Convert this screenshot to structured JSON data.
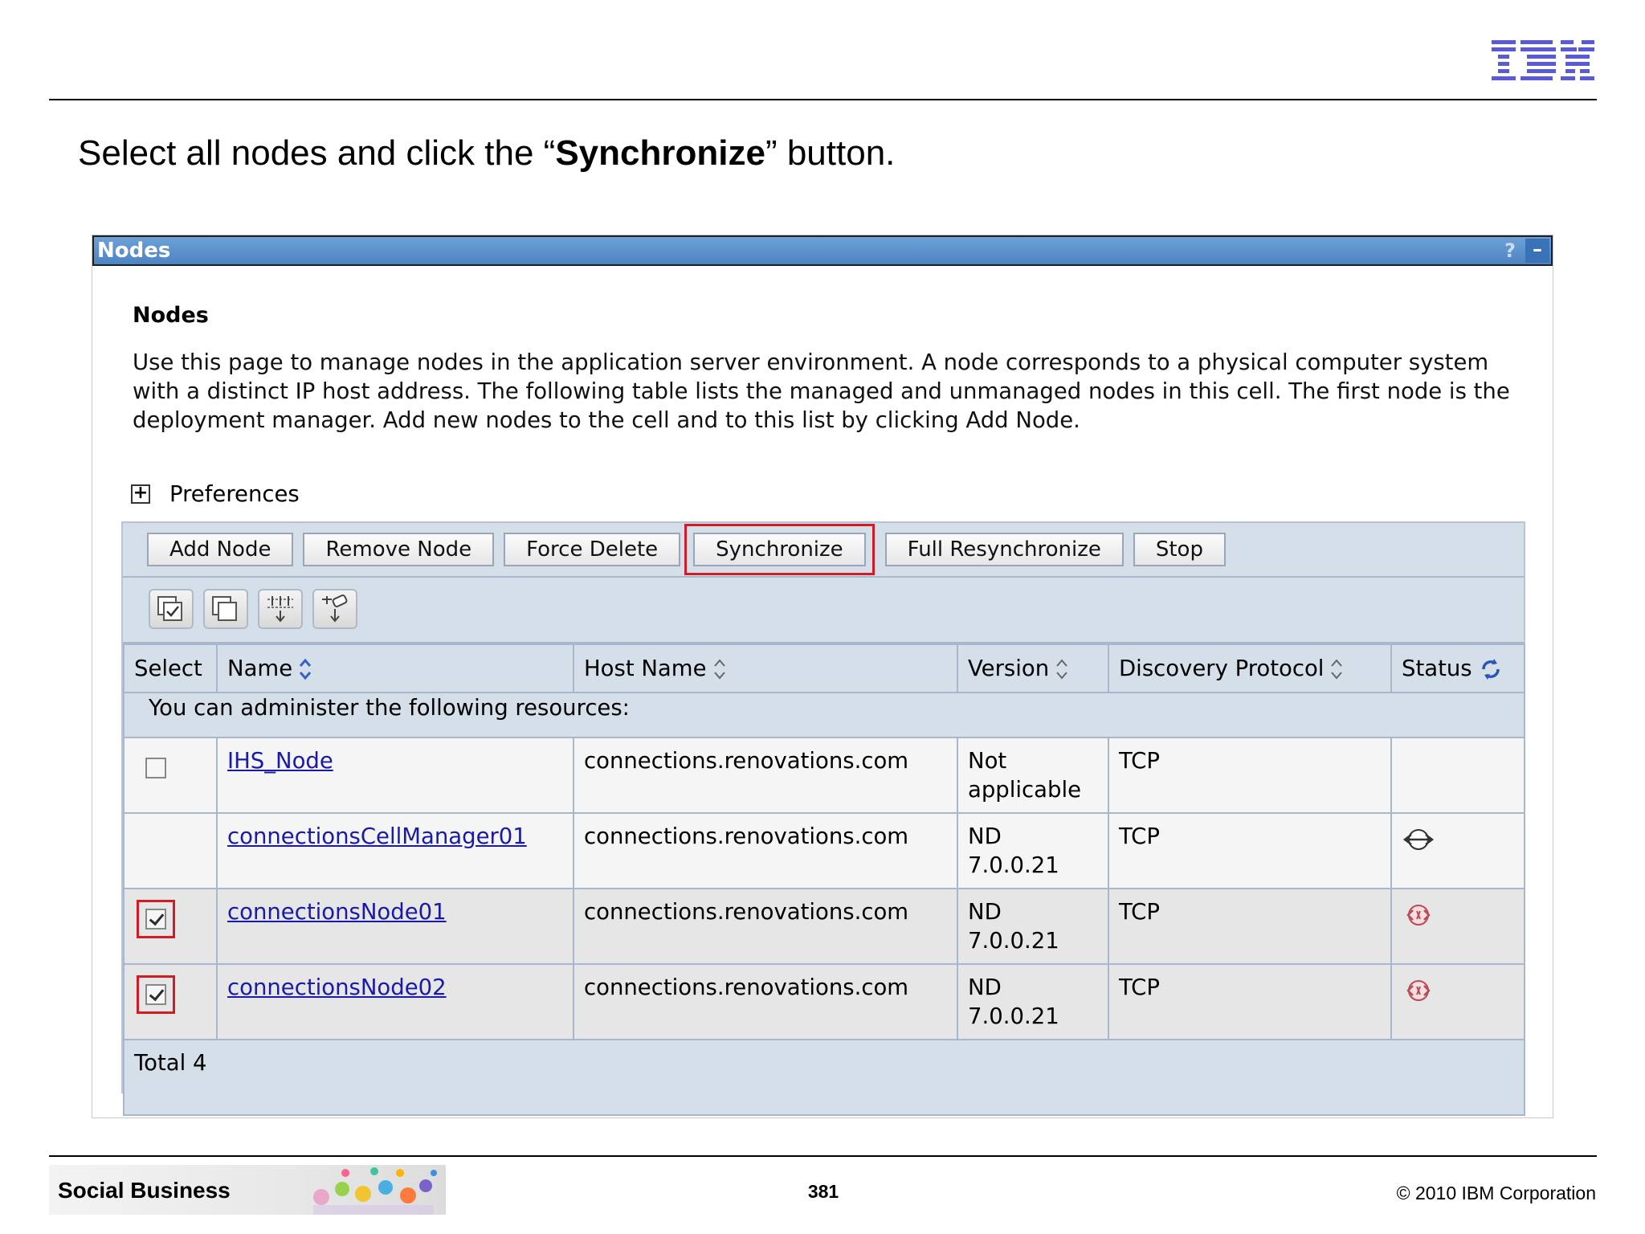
{
  "slide": {
    "title_prefix": "Select all nodes and click the “",
    "title_bold": "Synchronize",
    "title_suffix": "” button.",
    "footer_brand": "Social Business",
    "page_number": "381",
    "copyright": "© 2010 IBM Corporation",
    "logo_text": "IBM"
  },
  "portlet": {
    "title": "Nodes",
    "help_icon": "?",
    "minimize_icon": "–",
    "heading": "Nodes",
    "description": "Use this page to manage nodes in the application server environment. A node corresponds to a physical computer system with a distinct IP host address. The following table lists the managed and unmanaged nodes in this cell. The first node is the deployment manager. Add new nodes to the cell and to this list by clicking Add Node.",
    "preferences_label": "Preferences",
    "buttons": {
      "add_node": "Add Node",
      "remove_node": "Remove Node",
      "force_delete": "Force Delete",
      "synchronize": "Synchronize",
      "full_resync": "Full Resynchronize",
      "stop": "Stop"
    },
    "tool_icons": [
      "select-all-icon",
      "deselect-all-icon",
      "show-filter-icon",
      "clear-filter-icon"
    ],
    "table": {
      "headers": {
        "select": "Select",
        "name": "Name",
        "host": "Host Name",
        "version": "Version",
        "protocol": "Discovery Protocol",
        "status": "Status"
      },
      "resources_note": "You can administer the following resources:",
      "rows": [
        {
          "name": "IHS_Node",
          "host": "connections.renovations.com",
          "version_line1": "Not",
          "version_line2": "applicable",
          "protocol": "TCP",
          "checkbox": "unchecked",
          "status": ""
        },
        {
          "name": "connectionsCellManager01",
          "host": "connections.renovations.com",
          "version_line1": "ND",
          "version_line2": "7.0.0.21",
          "protocol": "TCP",
          "checkbox": "none",
          "status": "started-icon"
        },
        {
          "name": "connectionsNode01",
          "host": "connections.renovations.com",
          "version_line1": "ND",
          "version_line2": "7.0.0.21",
          "protocol": "TCP",
          "checkbox": "checked",
          "status": "not-synchronized-icon"
        },
        {
          "name": "connectionsNode02",
          "host": "connections.renovations.com",
          "version_line1": "ND",
          "version_line2": "7.0.0.21",
          "protocol": "TCP",
          "checkbox": "checked",
          "status": "not-synchronized-icon"
        }
      ],
      "total": "Total 4"
    },
    "colors": {
      "titlebar": "#4d84c3",
      "table_bg": "#d5dfea",
      "highlight": "#d01c24",
      "link": "#1a1aa8"
    }
  }
}
